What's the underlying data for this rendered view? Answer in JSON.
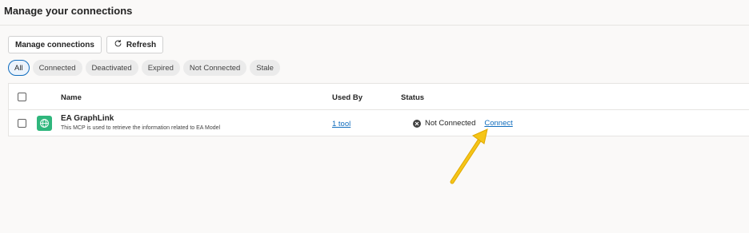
{
  "page": {
    "title": "Manage your connections"
  },
  "toolbar": {
    "manage_label": "Manage connections",
    "refresh_label": "Refresh"
  },
  "filters": [
    {
      "label": "All",
      "active": true
    },
    {
      "label": "Connected"
    },
    {
      "label": "Deactivated"
    },
    {
      "label": "Expired"
    },
    {
      "label": "Not Connected"
    },
    {
      "label": "Stale"
    }
  ],
  "table": {
    "columns": {
      "name": "Name",
      "used_by": "Used By",
      "status": "Status"
    },
    "rows": [
      {
        "name": "EA GraphLink",
        "description": "This MCP is used to retrieve the information related to EA Model",
        "used_by": "1 tool",
        "status": "Not Connected",
        "action": "Connect"
      }
    ]
  },
  "colors": {
    "accent": "#0f6cbd",
    "app_icon": "#2fb67c",
    "arrow": "#f2b90f"
  },
  "icons": {
    "refresh": "refresh-icon",
    "app": "globe-icon",
    "status": "close-circle-icon"
  }
}
